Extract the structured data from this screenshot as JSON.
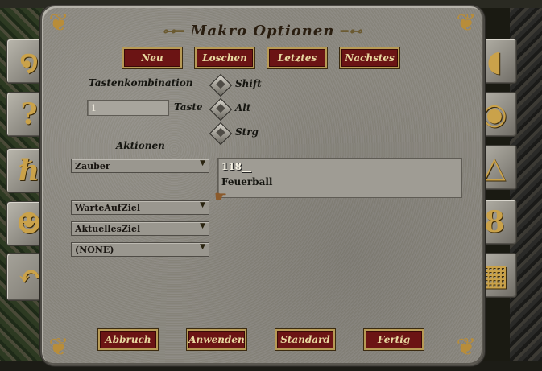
{
  "window": {
    "title": "Makro Optionen",
    "corner_ornament": "celtic-knot"
  },
  "colors": {
    "panel_stone": "#8b8881",
    "button_fill": "#6b1414",
    "button_border": "#b79a55",
    "button_text": "#e8d8a0",
    "tab_gold": "#caa24a"
  },
  "side_tabs": {
    "left": [
      {
        "icon": "scroll-curl-icon",
        "glyph": "໑"
      },
      {
        "icon": "question-hook-icon",
        "glyph": "?"
      },
      {
        "icon": "runic-h-icon",
        "glyph": "ℏ"
      },
      {
        "icon": "face-profile-icon",
        "glyph": "☻"
      },
      {
        "icon": "curved-arrow-icon",
        "glyph": "↶"
      }
    ],
    "right": [
      {
        "icon": "shield-icon",
        "glyph": "◖"
      },
      {
        "icon": "eye-icon",
        "glyph": "◉"
      },
      {
        "icon": "pyramid-icon",
        "glyph": "△"
      },
      {
        "icon": "figure-eight-icon",
        "glyph": "8"
      },
      {
        "icon": "grid-globe-icon",
        "glyph": "▦"
      }
    ]
  },
  "top_buttons": {
    "neu": "Neu",
    "loschen": "Loschen",
    "letztes": "Letztes",
    "nachstes": "Nachstes"
  },
  "keys": {
    "label": "Tastenkombination",
    "taste_label": "Taste",
    "taste_value": "1",
    "shift": "Shift",
    "alt": "Alt",
    "strg": "Strg"
  },
  "actions": {
    "label": "Aktionen",
    "dropdowns": [
      "Zauber",
      "WarteAufZiel",
      "AktuellesZiel",
      "(NONE)"
    ],
    "text_lines": [
      "118__",
      "Feuerball"
    ]
  },
  "bottom_buttons": {
    "abbruch": "Abbruch",
    "anwenden": "Anwenden",
    "standard": "Standard",
    "fertig": "Fertig"
  }
}
